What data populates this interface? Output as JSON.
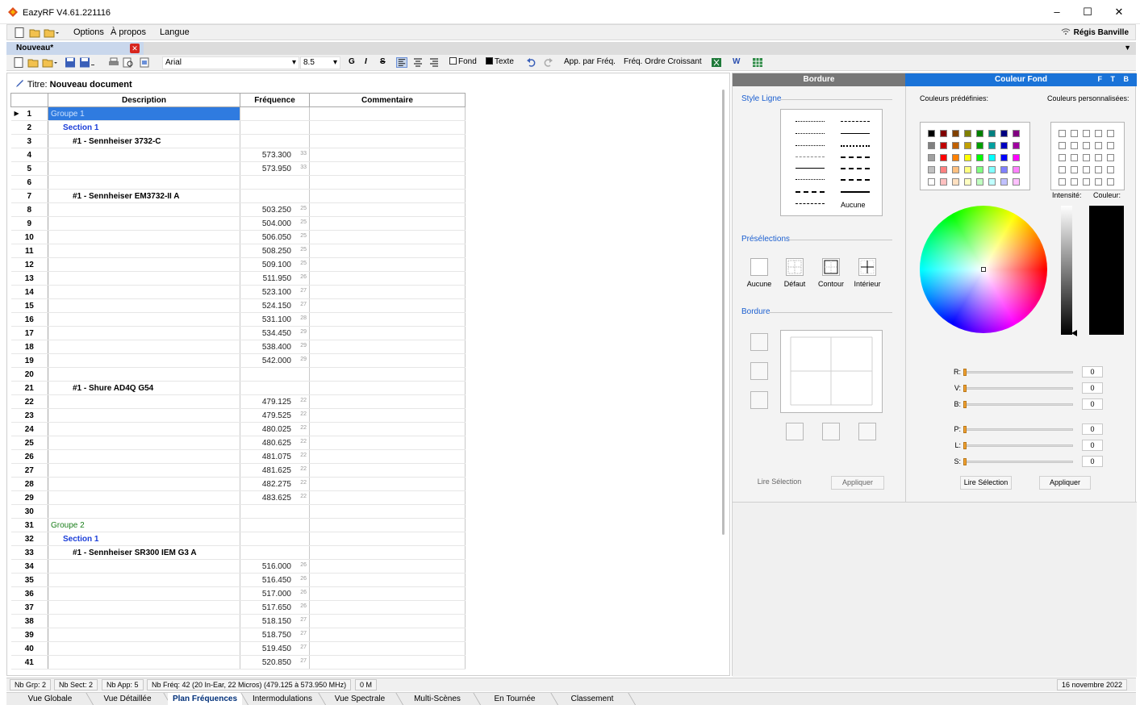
{
  "window": {
    "title": "EazyRF V4.61.221116",
    "minimize": "–",
    "maximize": "☐",
    "close": "✕"
  },
  "menu": {
    "options": "Options",
    "apropos": "À propos",
    "langue": "Langue",
    "user": "Régis Banville"
  },
  "doc_tab": {
    "label": "Nouveau*",
    "close": "✕",
    "dropdown": "▼"
  },
  "toolbar": {
    "font": "Arial",
    "font_arrow": "▾",
    "size": "8.5",
    "size_arrow": "▾",
    "bold": "G",
    "italic": "I",
    "strike": "S",
    "fond": "Fond",
    "texte": "Texte",
    "app_freq": "App. par Fréq.",
    "freq_order": "Fréq. Ordre Croissant",
    "word": "W"
  },
  "document": {
    "title_label": "Titre:",
    "title_value": "Nouveau document"
  },
  "grid": {
    "headers": [
      "Description",
      "Fréquence",
      "Commentaire"
    ],
    "rows": [
      {
        "n": "1",
        "type": "group",
        "desc": "Groupe 1",
        "freq": "",
        "sub": ""
      },
      {
        "n": "2",
        "type": "section",
        "desc": "Section 1",
        "freq": "",
        "sub": ""
      },
      {
        "n": "3",
        "type": "device",
        "desc": "#1 - Sennheiser 3732-C",
        "freq": "",
        "sub": ""
      },
      {
        "n": "4",
        "type": "freq",
        "desc": "",
        "freq": "573.300",
        "sub": "33"
      },
      {
        "n": "5",
        "type": "freq",
        "desc": "",
        "freq": "573.950",
        "sub": "33"
      },
      {
        "n": "6",
        "type": "blank",
        "desc": "",
        "freq": "",
        "sub": ""
      },
      {
        "n": "7",
        "type": "device",
        "desc": "#1 - Sennheiser EM3732-II A",
        "freq": "",
        "sub": ""
      },
      {
        "n": "8",
        "type": "freq",
        "desc": "",
        "freq": "503.250",
        "sub": "25"
      },
      {
        "n": "9",
        "type": "freq",
        "desc": "",
        "freq": "504.000",
        "sub": "25"
      },
      {
        "n": "10",
        "type": "freq",
        "desc": "",
        "freq": "506.050",
        "sub": "25"
      },
      {
        "n": "11",
        "type": "freq",
        "desc": "",
        "freq": "508.250",
        "sub": "25"
      },
      {
        "n": "12",
        "type": "freq",
        "desc": "",
        "freq": "509.100",
        "sub": "25"
      },
      {
        "n": "13",
        "type": "freq",
        "desc": "",
        "freq": "511.950",
        "sub": "26"
      },
      {
        "n": "14",
        "type": "freq",
        "desc": "",
        "freq": "523.100",
        "sub": "27"
      },
      {
        "n": "15",
        "type": "freq",
        "desc": "",
        "freq": "524.150",
        "sub": "27"
      },
      {
        "n": "16",
        "type": "freq",
        "desc": "",
        "freq": "531.100",
        "sub": "28"
      },
      {
        "n": "17",
        "type": "freq",
        "desc": "",
        "freq": "534.450",
        "sub": "29"
      },
      {
        "n": "18",
        "type": "freq",
        "desc": "",
        "freq": "538.400",
        "sub": "29"
      },
      {
        "n": "19",
        "type": "freq",
        "desc": "",
        "freq": "542.000",
        "sub": "29"
      },
      {
        "n": "20",
        "type": "blank",
        "desc": "",
        "freq": "",
        "sub": ""
      },
      {
        "n": "21",
        "type": "device",
        "desc": "#1 - Shure AD4Q G54",
        "freq": "",
        "sub": ""
      },
      {
        "n": "22",
        "type": "freq",
        "desc": "",
        "freq": "479.125",
        "sub": "22"
      },
      {
        "n": "23",
        "type": "freq",
        "desc": "",
        "freq": "479.525",
        "sub": "22"
      },
      {
        "n": "24",
        "type": "freq",
        "desc": "",
        "freq": "480.025",
        "sub": "22"
      },
      {
        "n": "25",
        "type": "freq",
        "desc": "",
        "freq": "480.625",
        "sub": "22"
      },
      {
        "n": "26",
        "type": "freq",
        "desc": "",
        "freq": "481.075",
        "sub": "22"
      },
      {
        "n": "27",
        "type": "freq",
        "desc": "",
        "freq": "481.625",
        "sub": "22"
      },
      {
        "n": "28",
        "type": "freq",
        "desc": "",
        "freq": "482.275",
        "sub": "22"
      },
      {
        "n": "29",
        "type": "freq",
        "desc": "",
        "freq": "483.625",
        "sub": "22"
      },
      {
        "n": "30",
        "type": "blank",
        "desc": "",
        "freq": "",
        "sub": ""
      },
      {
        "n": "31",
        "type": "group",
        "desc": "Groupe 2",
        "freq": "",
        "sub": ""
      },
      {
        "n": "32",
        "type": "section",
        "desc": "Section 1",
        "freq": "",
        "sub": ""
      },
      {
        "n": "33",
        "type": "device",
        "desc": "#1 - Sennheiser SR300 IEM G3 A",
        "freq": "",
        "sub": ""
      },
      {
        "n": "34",
        "type": "freq",
        "desc": "",
        "freq": "516.000",
        "sub": "26"
      },
      {
        "n": "35",
        "type": "freq",
        "desc": "",
        "freq": "516.450",
        "sub": "26"
      },
      {
        "n": "36",
        "type": "freq",
        "desc": "",
        "freq": "517.000",
        "sub": "26"
      },
      {
        "n": "37",
        "type": "freq",
        "desc": "",
        "freq": "517.650",
        "sub": "26"
      },
      {
        "n": "38",
        "type": "freq",
        "desc": "",
        "freq": "518.150",
        "sub": "27"
      },
      {
        "n": "39",
        "type": "freq",
        "desc": "",
        "freq": "518.750",
        "sub": "27"
      },
      {
        "n": "40",
        "type": "freq",
        "desc": "",
        "freq": "519.450",
        "sub": "27"
      },
      {
        "n": "41",
        "type": "freq",
        "desc": "",
        "freq": "520.850",
        "sub": "27"
      }
    ]
  },
  "statusbar": {
    "nb_grp": "Nb Grp: 2",
    "nb_sect": "Nb Sect: 2",
    "nb_app": "Nb App: 5",
    "nb_freq": "Nb Fréq: 42 (20 In-Ear, 22 Micros) (479.125 à 573.950 MHz)",
    "mem": "0 M",
    "date": "16 novembre 2022"
  },
  "bottom_tabs": [
    "Vue Globale",
    "Vue Détaillée",
    "Plan Fréquences",
    "Intermodulations",
    "Vue Spectrale",
    "Multi-Scènes",
    "En Tournée",
    "Classement"
  ],
  "active_tab": "Plan Fréquences",
  "right_panel": {
    "border_header": "Bordure",
    "bg_header": "Couleur Fond",
    "header_letters": "F T B",
    "style_ligne": "Style Ligne",
    "aucune_style": "Aucune",
    "preselections": "Présélections",
    "presets": [
      "Aucune",
      "Défaut",
      "Contour",
      "Intérieur"
    ],
    "bordure": "Bordure",
    "lire_selection": "Lire Sélection",
    "appliquer": "Appliquer",
    "couleurs_predefinies": "Couleurs prédéfinies:",
    "couleurs_perso": "Couleurs personnalisées:",
    "intensite": "Intensité:",
    "couleur": "Couleur:",
    "sliders": [
      {
        "label": "R:",
        "value": "0"
      },
      {
        "label": "V:",
        "value": "0"
      },
      {
        "label": "B:",
        "value": "0"
      },
      {
        "label": "P:",
        "value": "0"
      },
      {
        "label": "L:",
        "value": "0"
      },
      {
        "label": "S:",
        "value": "0"
      }
    ],
    "palette": [
      [
        "#000000",
        "#800000",
        "#804000",
        "#808000",
        "#008000",
        "#008080",
        "#000080",
        "#800080"
      ],
      [
        "#808080",
        "#c00000",
        "#c06000",
        "#c0a000",
        "#00a000",
        "#00a0a0",
        "#0000c0",
        "#a000a0"
      ],
      [
        "#a0a0a0",
        "#ff0000",
        "#ff8000",
        "#ffff00",
        "#00ff00",
        "#00ffff",
        "#0000ff",
        "#ff00ff"
      ],
      [
        "#c0c0c0",
        "#ff8080",
        "#ffc080",
        "#ffff80",
        "#80ff80",
        "#80ffff",
        "#8080ff",
        "#ff80ff"
      ],
      [
        "#ffffff",
        "#ffc0c0",
        "#ffe0c0",
        "#ffffc0",
        "#c0ffc0",
        "#c0ffff",
        "#c0c0ff",
        "#ffc0ff"
      ]
    ]
  }
}
